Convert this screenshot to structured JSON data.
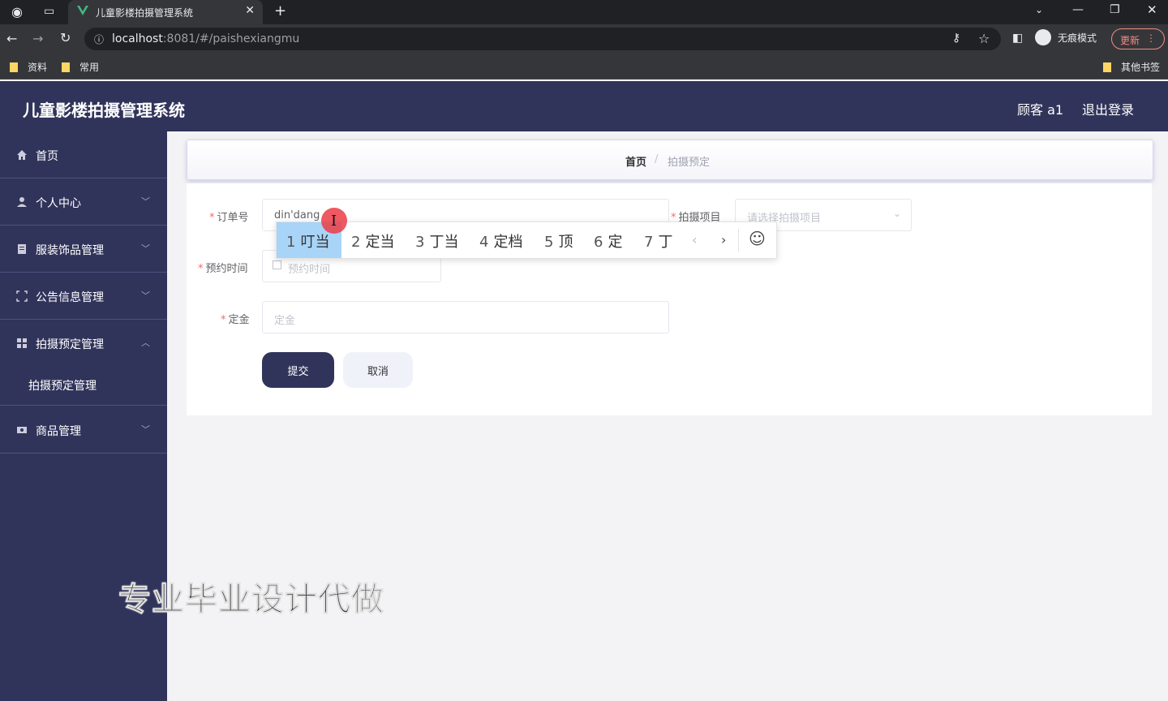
{
  "browser": {
    "tab_title": "儿童影楼拍摄管理系统",
    "tab_close": "✕",
    "new_tab": "+",
    "url_host": "localhost",
    "url_rest": ":8081/#/paishexiangmu",
    "profile_label": "无痕模式",
    "update_label": "更新",
    "bookmarks": [
      "资料",
      "常用"
    ],
    "other_bookmarks": "其他书签"
  },
  "header": {
    "title": "儿童影楼拍摄管理系统",
    "user": "顾客 a1",
    "logout": "退出登录"
  },
  "sidebar": {
    "items": [
      {
        "label": "首页",
        "icon": "home-icon"
      },
      {
        "label": "个人中心",
        "icon": "user-icon"
      },
      {
        "label": "服装饰品管理",
        "icon": "document-icon"
      },
      {
        "label": "公告信息管理",
        "icon": "frame-icon"
      },
      {
        "label": "拍摄预定管理",
        "icon": "grid-icon"
      },
      {
        "label": "商品管理",
        "icon": "ticket-icon"
      }
    ],
    "submenu": [
      "拍摄预定管理"
    ]
  },
  "breadcrumb": {
    "home": "首页",
    "separator": "/",
    "current": "拍摄预定"
  },
  "form": {
    "order_no": {
      "label": "订单号",
      "value": "din'dang"
    },
    "project": {
      "label": "拍摄项目",
      "placeholder": "请选择拍摄项目"
    },
    "time": {
      "label": "预约时间",
      "placeholder": "预约时间"
    },
    "deposit": {
      "label": "定金",
      "placeholder": "定金"
    },
    "submit": "提交",
    "cancel": "取消"
  },
  "ime": {
    "candidates": [
      {
        "num": "1",
        "text": "叮当"
      },
      {
        "num": "2",
        "text": "定当"
      },
      {
        "num": "3",
        "text": "丁当"
      },
      {
        "num": "4",
        "text": "定档"
      },
      {
        "num": "5",
        "text": "顶"
      },
      {
        "num": "6",
        "text": "定"
      },
      {
        "num": "7",
        "text": "丁"
      }
    ],
    "prev": "‹",
    "next": "›",
    "emoji": "☺"
  },
  "watermark": "专业毕业设计代做",
  "colors": {
    "primary": "#31345a",
    "required": "#f56c6c",
    "ime_highlight": "#a8d4f7"
  }
}
